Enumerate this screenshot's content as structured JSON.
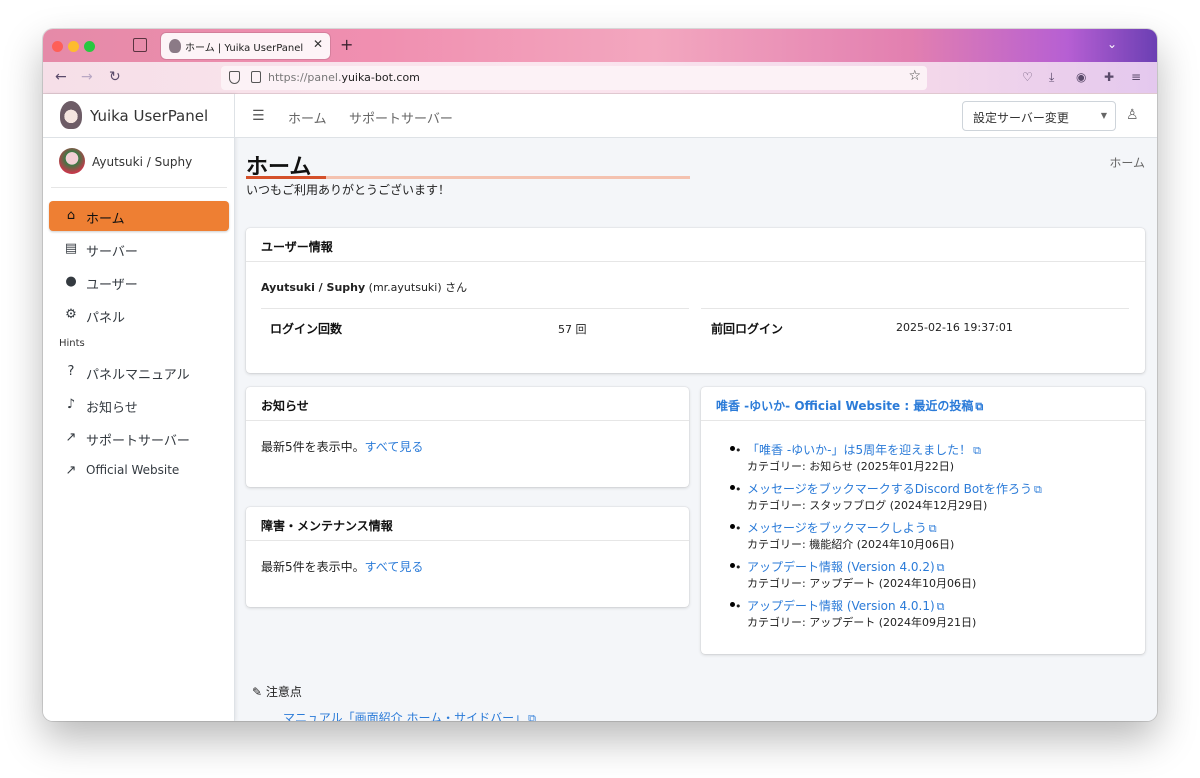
{
  "browser": {
    "tab_title": "ホーム | Yuika UserPanel",
    "url_prefix": "https://panel.",
    "url_domain": "yuika-bot.com"
  },
  "brand": {
    "name": "Yuika UserPanel"
  },
  "user": {
    "display_name": "Ayutsuki / Suphy"
  },
  "sidebar": {
    "items": [
      {
        "label": "ホーム",
        "active": true
      },
      {
        "label": "サーバー"
      },
      {
        "label": "ユーザー"
      },
      {
        "label": "パネル"
      }
    ],
    "hints_header": "Hints",
    "hints": [
      {
        "label": "パネルマニュアル"
      },
      {
        "label": "お知らせ"
      },
      {
        "label": "サポートサーバー"
      },
      {
        "label": "Official Website"
      }
    ]
  },
  "topnav": {
    "links": [
      "ホーム",
      "サポートサーバー"
    ],
    "server_select": "設定サーバー変更"
  },
  "page": {
    "title": "ホーム",
    "welcome": "いつもご利用ありがとうございます！",
    "breadcrumb": "ホーム"
  },
  "user_info": {
    "title": "ユーザー情報",
    "name": "Ayutsuki / Suphy",
    "handle": "(mr.ayutsuki)",
    "suffix": "さん",
    "login_count_label": "ログイン回数",
    "login_count_value": "57 回",
    "last_login_label": "前回ログイン",
    "last_login_value": "2025-02-16 19:37:01"
  },
  "news": {
    "title": "お知らせ",
    "text": "最新5件を表示中。",
    "link": "すべて見る"
  },
  "maintenance": {
    "title": "障害・メンテナンス情報",
    "text": "最新5件を表示中。",
    "link": "すべて見る"
  },
  "website": {
    "title": "唯香 -ゆいか- Official Website : 最近の投稿",
    "posts": [
      {
        "title": "「唯香 -ゆいか-」は5周年を迎えました！",
        "category": "カテゴリー: お知らせ (2025年01月22日)"
      },
      {
        "title": "メッセージをブックマークするDiscord Botを作ろう",
        "category": "カテゴリー: スタッフブログ (2024年12月29日)"
      },
      {
        "title": "メッセージをブックマークしよう",
        "category": "カテゴリー: 機能紹介 (2024年10月06日)"
      },
      {
        "title": "アップデート情報 (Version 4.0.2)",
        "category": "カテゴリー: アップデート (2024年10月06日)"
      },
      {
        "title": "アップデート情報 (Version 4.0.1)",
        "category": "カテゴリー: アップデート (2024年09月21日)"
      }
    ]
  },
  "notes": {
    "title": "注意点",
    "link": "マニュアル「画面紹介 ホーム・サイドバー」"
  },
  "colors": {
    "accent": "#ee7f33",
    "link": "#2b7bd8"
  }
}
